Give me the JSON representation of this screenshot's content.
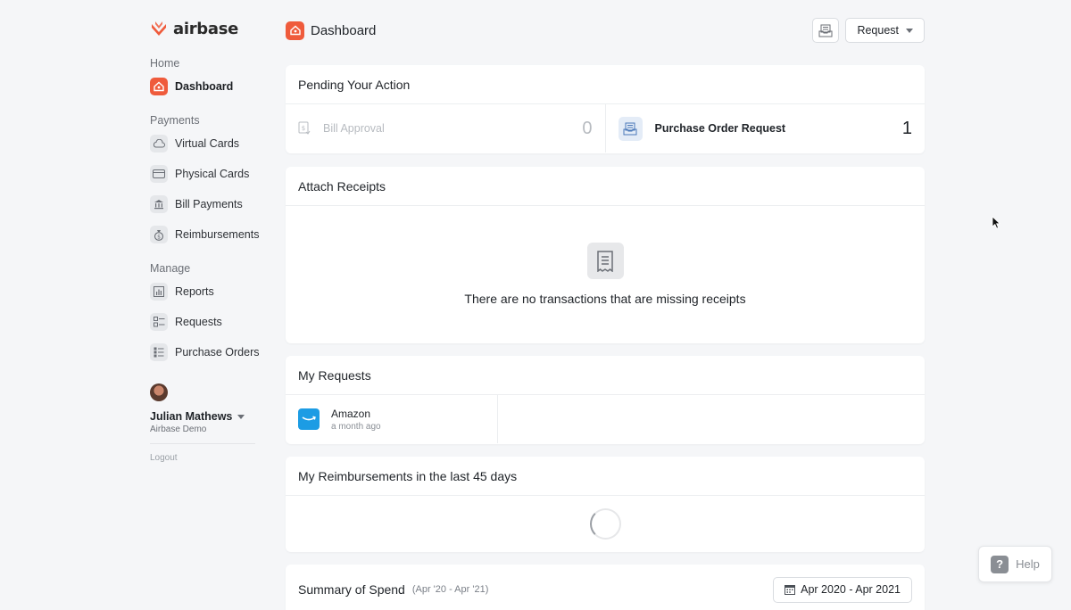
{
  "brand": {
    "name": "airbase",
    "accent": "#ef5b3c"
  },
  "sidebar": {
    "sections": [
      {
        "label": "Home",
        "items": [
          {
            "label": "Dashboard",
            "icon": "home-icon",
            "active": true
          }
        ]
      },
      {
        "label": "Payments",
        "items": [
          {
            "label": "Virtual Cards",
            "icon": "cloud-icon"
          },
          {
            "label": "Physical Cards",
            "icon": "card-icon"
          },
          {
            "label": "Bill Payments",
            "icon": "bank-icon"
          },
          {
            "label": "Reimbursements",
            "icon": "money-bag-icon"
          }
        ]
      },
      {
        "label": "Manage",
        "items": [
          {
            "label": "Reports",
            "icon": "chart-icon"
          },
          {
            "label": "Requests",
            "icon": "checklist-icon"
          },
          {
            "label": "Purchase Orders",
            "icon": "list-icon"
          }
        ]
      }
    ],
    "user": {
      "name": "Julian Mathews",
      "org": "Airbase Demo"
    },
    "logout": "Logout"
  },
  "header": {
    "title": "Dashboard",
    "request_label": "Request"
  },
  "pending": {
    "title": "Pending Your Action",
    "items": [
      {
        "label": "Bill Approval",
        "count": "0"
      },
      {
        "label": "Purchase Order Request",
        "count": "1"
      }
    ]
  },
  "receipts": {
    "title": "Attach Receipts",
    "empty_text": "There are no transactions that are missing receipts"
  },
  "my_requests": {
    "title": "My Requests",
    "items": [
      {
        "vendor": "Amazon",
        "time": "a month ago"
      }
    ]
  },
  "reimbursements": {
    "title": "My Reimbursements in the last 45 days"
  },
  "summary": {
    "title": "Summary of Spend",
    "range": "(Apr '20 - Apr '21)",
    "date_button": "Apr 2020 - Apr 2021"
  },
  "help": {
    "label": "Help"
  }
}
